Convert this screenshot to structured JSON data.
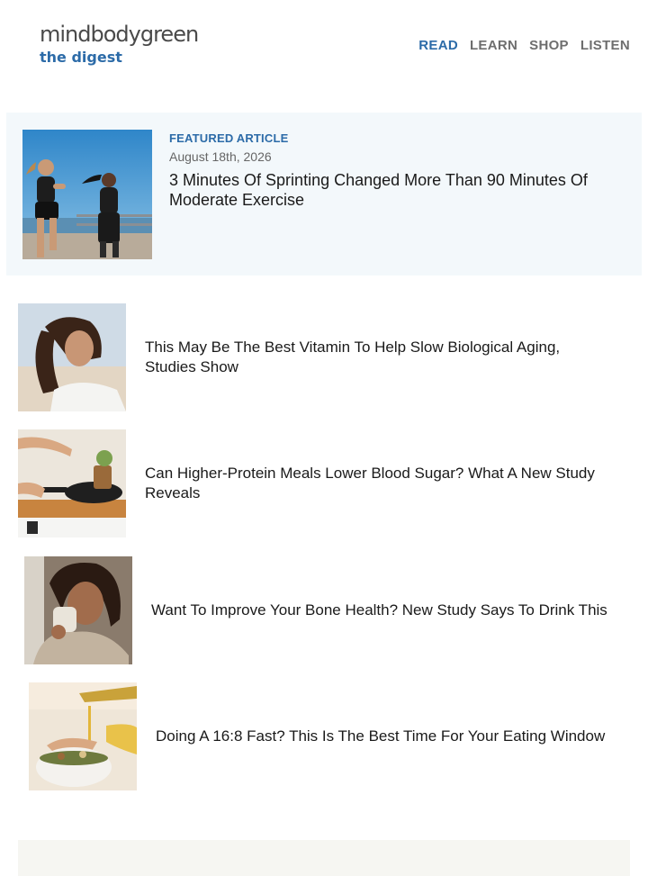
{
  "brand": {
    "name": "mindbodygreen",
    "subtitle": "the digest"
  },
  "nav": [
    "READ",
    "LEARN",
    "SHOP",
    "LISTEN"
  ],
  "featured": {
    "kicker": "FEATURED ARTICLE",
    "date": "August 18th, 2026",
    "title": "3 Minutes Of Sprinting Changed More Than 90 Minutes Of Moderate Exercise",
    "image": "two-women-sprinting-photo"
  },
  "articles": [
    {
      "title": "This May Be The Best Vitamin To Help Slow Biological Aging, Studies Show",
      "image": "woman-curly-hair-beach-photo"
    },
    {
      "title": "Can Higher-Protein Meals Lower Blood Sugar? What A New Study Reveals",
      "image": "cooking-kitchen-pan-photo"
    },
    {
      "title": "Want To Improve Your Bone Health? New Study Says To Drink This",
      "image": "woman-drinking-mug-photo"
    },
    {
      "title": "Doing A 16:8 Fast? This Is The Best Time For Your Eating Window",
      "image": "oil-pouring-bowl-photo"
    }
  ],
  "colors": {
    "accent": "#2c6ba8",
    "featured_bg": "#f3f8fb",
    "nav_inactive": "#6e6e6e",
    "text": "#1a1a1a"
  }
}
